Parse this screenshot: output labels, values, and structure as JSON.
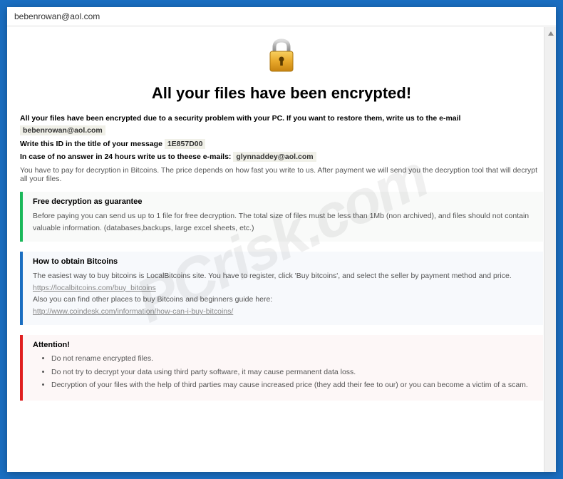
{
  "window": {
    "title": "bebenrowan@aol.com"
  },
  "heading": "All your files have been encrypted!",
  "intro": {
    "line1_prefix": "All your files have been encrypted due to a security problem with your PC. If you want to restore them, write us to the e-mail ",
    "email1": "bebenrowan@aol.com",
    "line2_prefix": "Write this ID in the title of your message ",
    "message_id": "1E857D00",
    "line3_prefix": "In case of no answer in 24 hours write us to theese e-mails: ",
    "email2": "glynnaddey@aol.com"
  },
  "payline": "You have to pay for decryption in Bitcoins. The price depends on how fast you write to us. After payment we will send you the decryption tool that will decrypt all your files.",
  "sections": {
    "guarantee": {
      "title": "Free decryption as guarantee",
      "body": "Before paying you can send us up to 1 file for free decryption. The total size of files must be less than 1Mb (non archived), and files should not contain valuable information. (databases,backups, large excel sheets, etc.)"
    },
    "obtain": {
      "title": "How to obtain Bitcoins",
      "body1": "The easiest way to buy bitcoins is LocalBitcoins site. You have to register, click 'Buy bitcoins', and select the seller by payment method and price.",
      "link1": "https://localbitcoins.com/buy_bitcoins",
      "body2": "Also you can find other places to buy Bitcoins and beginners guide here:",
      "link2": "http://www.coindesk.com/information/how-can-i-buy-bitcoins/"
    },
    "attention": {
      "title": "Attention!",
      "items": [
        "Do not rename encrypted files.",
        "Do not try to decrypt your data using third party software, it may cause permanent data loss.",
        "Decryption of your files with the help of third parties may cause increased price (they add their fee to our) or you can become a victim of a scam."
      ]
    }
  }
}
